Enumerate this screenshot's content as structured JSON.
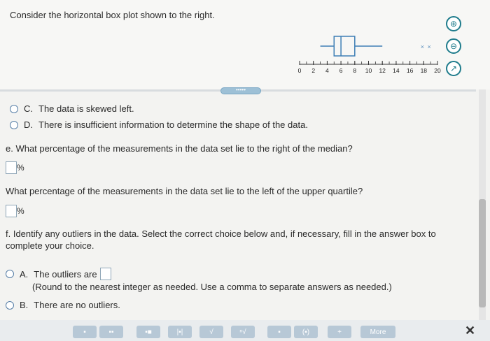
{
  "question": {
    "intro": "Consider the horizontal box plot shown to the right."
  },
  "boxplot": {
    "axis_ticks": [
      "0",
      "2",
      "4",
      "6",
      "8",
      "10",
      "12",
      "14",
      "16",
      "18",
      "20"
    ],
    "min": 3,
    "q1": 5,
    "median": 6,
    "q3": 8,
    "max": 12,
    "outlier_marks": [
      "×",
      "×"
    ]
  },
  "options_d": {
    "c_letter": "C.",
    "c_text": "The data is skewed left.",
    "d_letter": "D.",
    "d_text": "There is insufficient information to determine the shape of the data."
  },
  "part_e": {
    "prompt": "e. What percentage of the measurements in the data set lie to the right of the median?",
    "unit": "%",
    "prompt2": "What percentage of the measurements in the data set lie to the left of the upper quartile?",
    "unit2": "%"
  },
  "part_f": {
    "prompt_line1": "f. Identify any outliers in the data. Select the correct choice below and, if necessary, fill in the answer box to",
    "prompt_line2": "complete your choice.",
    "a_letter": "A.",
    "a_text": "The outliers are",
    "a_hint": "(Round to the nearest integer as needed. Use a comma to separate answers as needed.)",
    "b_letter": "B.",
    "b_text": "There are no outliers."
  },
  "handle_label": "•••••",
  "toolbar": {
    "more_label": "More",
    "close_label": "✕"
  }
}
